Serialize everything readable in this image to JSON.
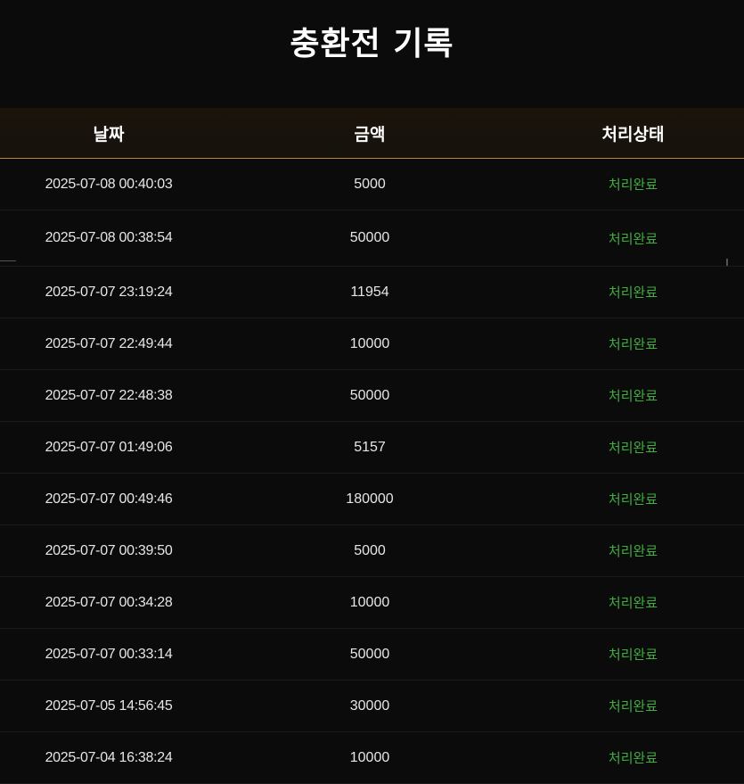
{
  "page": {
    "title": "충환전 기록"
  },
  "table": {
    "headers": {
      "date": "날짜",
      "amount": "금액",
      "status": "처리상태"
    },
    "rows": [
      {
        "date": "2025-07-08 00:40:03",
        "amount": "5000",
        "status": "처리완료"
      },
      {
        "date": "2025-07-08 00:38:54",
        "amount": "50000",
        "status": "처리완료"
      },
      {
        "date": "2025-07-07 23:19:24",
        "amount": "11954",
        "status": "처리완료"
      },
      {
        "date": "2025-07-07 22:49:44",
        "amount": "10000",
        "status": "처리완료"
      },
      {
        "date": "2025-07-07 22:48:38",
        "amount": "50000",
        "status": "처리완료"
      },
      {
        "date": "2025-07-07 01:49:06",
        "amount": "5157",
        "status": "처리완료"
      },
      {
        "date": "2025-07-07 00:49:46",
        "amount": "180000",
        "status": "처리완료"
      },
      {
        "date": "2025-07-07 00:39:50",
        "amount": "5000",
        "status": "처리완료"
      },
      {
        "date": "2025-07-07 00:34:28",
        "amount": "10000",
        "status": "처리완료"
      },
      {
        "date": "2025-07-07 00:33:14",
        "amount": "50000",
        "status": "처리완료"
      },
      {
        "date": "2025-07-05 14:56:45",
        "amount": "30000",
        "status": "처리완료"
      },
      {
        "date": "2025-07-04 16:38:24",
        "amount": "10000",
        "status": "처리완료"
      }
    ]
  },
  "colors": {
    "background": "#0b0b0b",
    "header_border": "#b98a3a",
    "status_complete": "#3fae3f"
  }
}
